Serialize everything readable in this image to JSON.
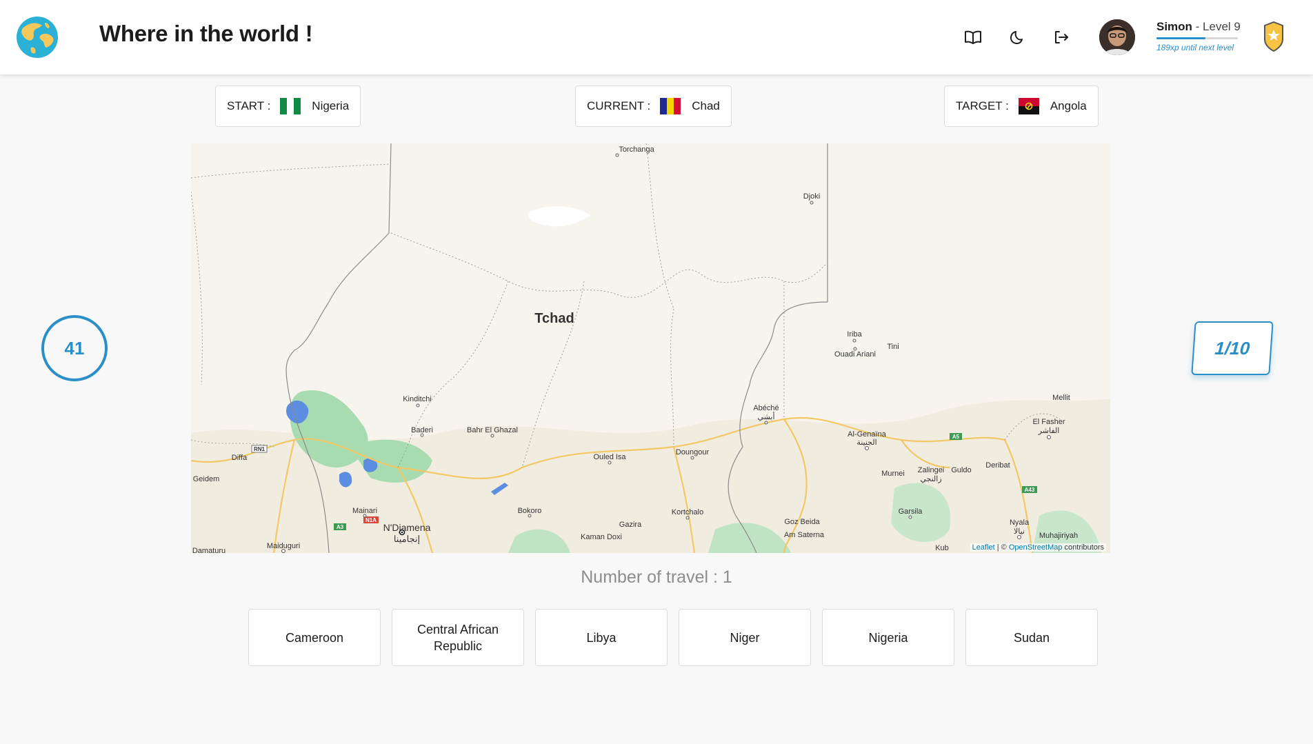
{
  "app": {
    "title": "Where in the world !"
  },
  "header": {
    "icons": [
      "book-icon",
      "moon-icon",
      "logout-icon"
    ],
    "user": {
      "name": "Simon",
      "level_text": " - Level 9",
      "xp_progress": 0.6,
      "xp_note": "189xp until next level"
    }
  },
  "route": {
    "start": {
      "label": "START :",
      "country": "Nigeria"
    },
    "current": {
      "label": "CURRENT :",
      "country": "Chad"
    },
    "target": {
      "label": "TARGET :",
      "country": "Angola"
    }
  },
  "timer": {
    "value": "41"
  },
  "round": {
    "value": "1/10"
  },
  "map": {
    "country_label": "Tchad",
    "places": [
      "Torchanga",
      "Djoki",
      "Iriba",
      "Tini",
      "Ouadi Ariani",
      "Mellit",
      "Kinditchi",
      "Abéché",
      "أبشي",
      "El Fasher",
      "الفاشر",
      "Baderi",
      "Bahr El Ghazal",
      "Al-Genaïna",
      "الجنينة",
      "Diffa",
      "Ouled Isa",
      "Doungour",
      "Deribat",
      "Geidem",
      "Murnei",
      "Zalingei",
      "زالنجي",
      "Guldo",
      "Mainari",
      "Bokoro",
      "Kortchalo",
      "Garsila",
      "N'Djamena",
      "إنجامينا",
      "Gazira",
      "Goz Beida",
      "Nyala",
      "نيالا",
      "Kaman Doxi",
      "Am Saterna",
      "Muhajiriyah",
      "Maiduguri",
      "Damaturu",
      "Kub"
    ],
    "road_shields": [
      "RN1",
      "A3",
      "N1A",
      "A5",
      "A43"
    ],
    "attribution": {
      "leaflet": "Leaflet",
      "separator": " | © ",
      "osm": "OpenStreetMap",
      "suffix": " contributors"
    }
  },
  "travel": {
    "text": "Number of travel : 1"
  },
  "choices": [
    "Cameroon",
    "Central African Republic",
    "Libya",
    "Niger",
    "Nigeria",
    "Sudan"
  ],
  "colors": {
    "accent": "#2a8ec8",
    "map_land": "#f7f4ee",
    "map_green": "#a8dcb0",
    "map_water": "#5b8ee0",
    "map_road": "#f2c766"
  }
}
